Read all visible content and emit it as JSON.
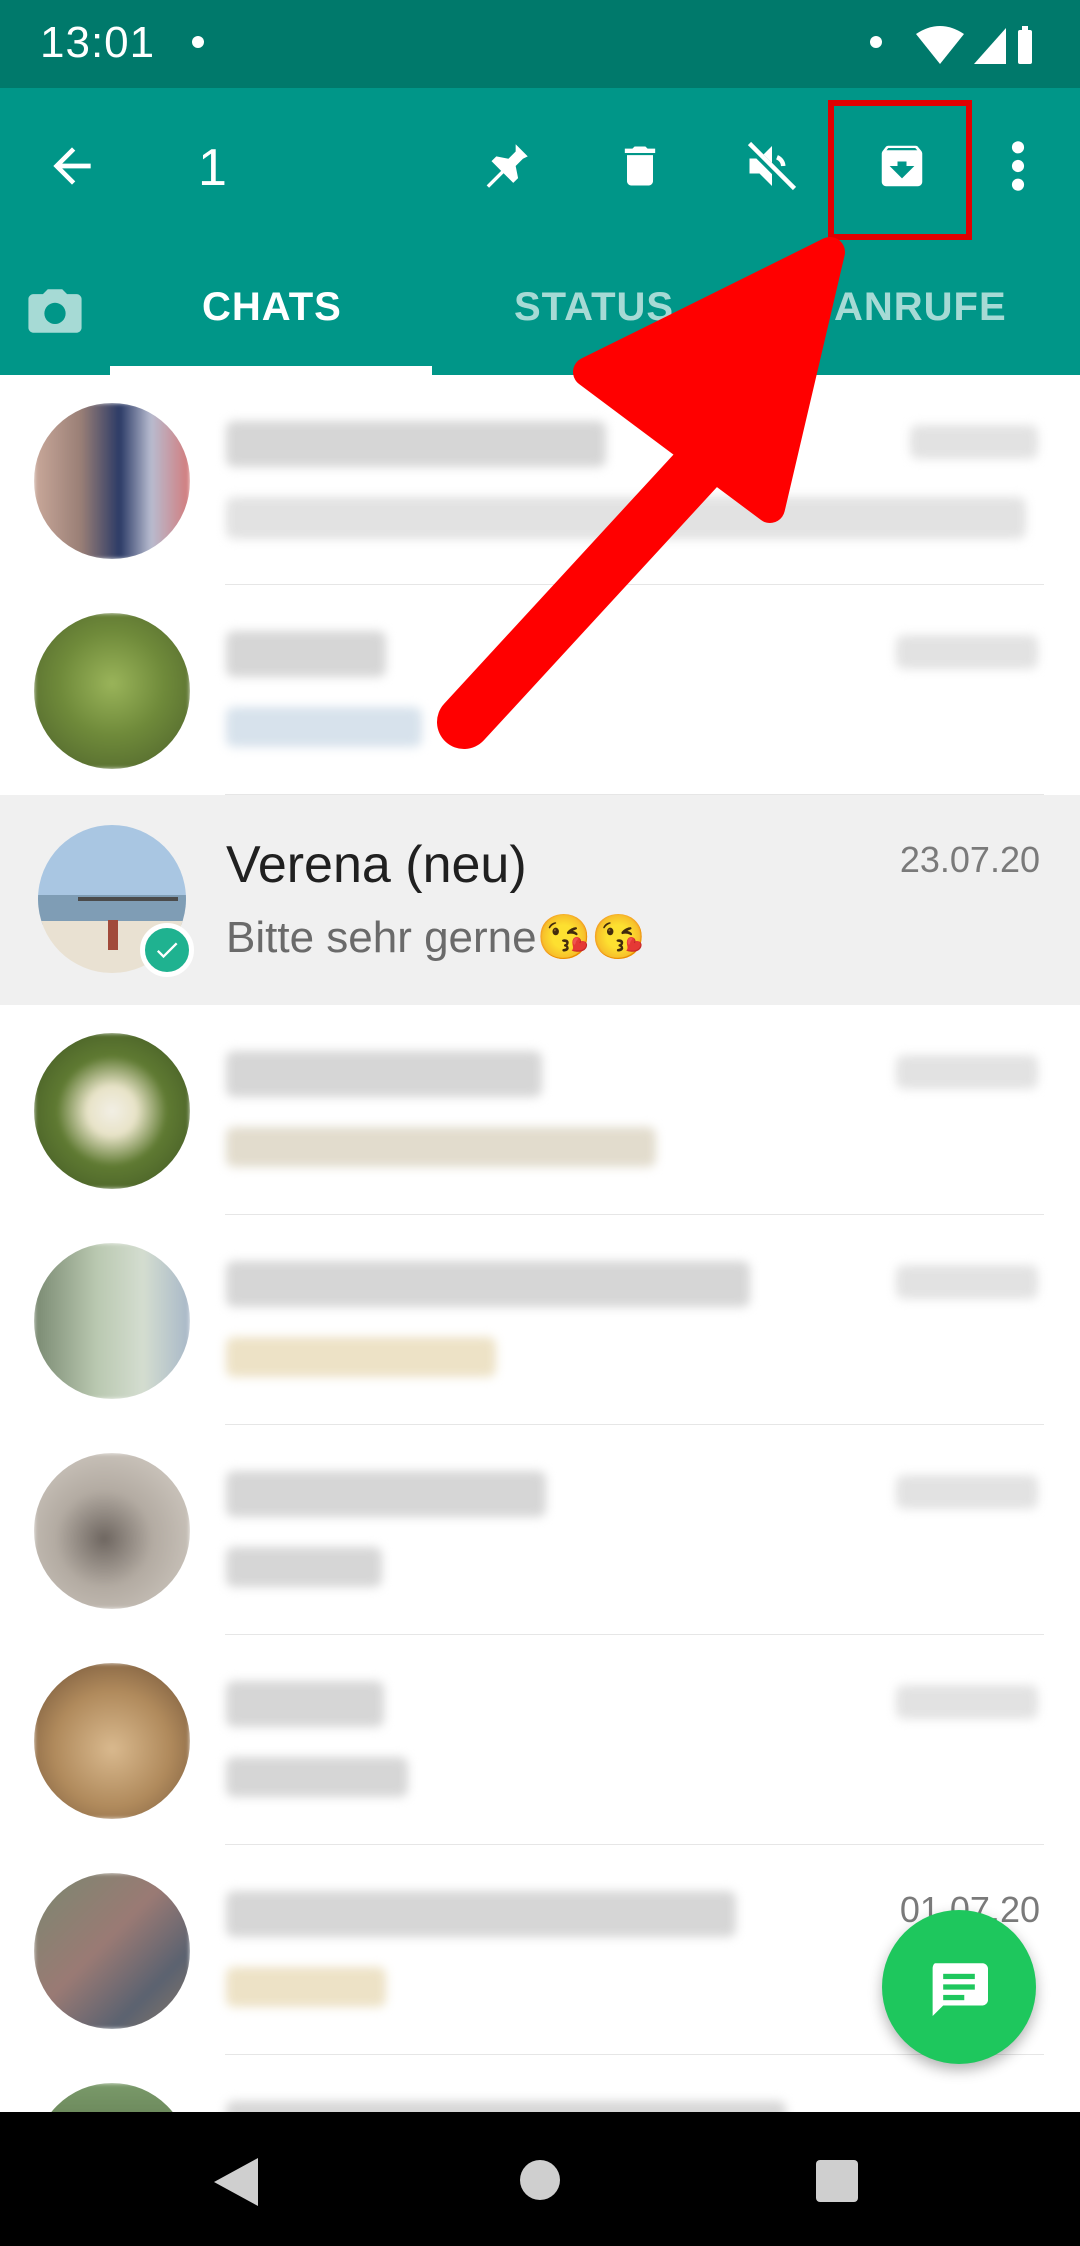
{
  "status_bar": {
    "time": "13:01"
  },
  "action_bar": {
    "selected_count": "1"
  },
  "tabs": {
    "chats": "CHATS",
    "status": "STATUS",
    "calls": "ANRUFE"
  },
  "selected_chat": {
    "name": "Verena (neu)",
    "date": "23.07.20",
    "message": "Bitte sehr gerne😘😘"
  },
  "visible_dates": {
    "row8": "01.07.20"
  },
  "colors": {
    "toolbar": "#009688",
    "statusbar": "#00796b",
    "fab": "#1ec75d",
    "highlight": "#e10000"
  },
  "icons": [
    "back-arrow-icon",
    "pin-icon",
    "delete-icon",
    "mute-icon",
    "archive-icon",
    "more-vert-icon",
    "camera-icon",
    "new-chat-icon",
    "nav-back-icon",
    "nav-home-icon",
    "nav-recents-icon"
  ]
}
